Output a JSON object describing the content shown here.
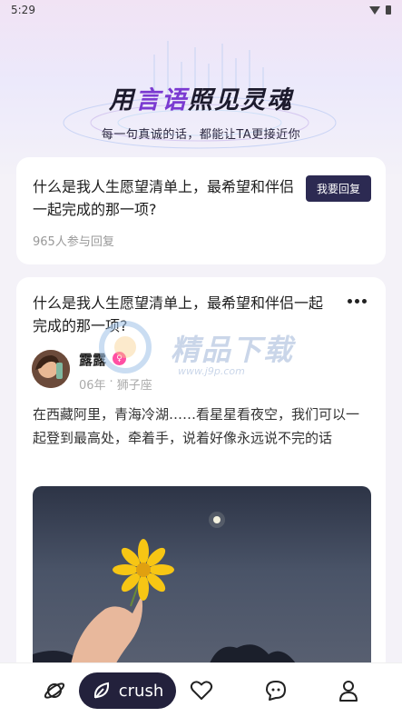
{
  "status_bar": {
    "time": "5:29"
  },
  "banner": {
    "slogan_part1": "用",
    "slogan_accent": "言语",
    "slogan_part2": "照见灵魂",
    "subtitle": "每一句真诚的话，都能让TA更接近你"
  },
  "question_card": {
    "question": "什么是我人生愿望清单上，最希望和伴侣一起完成的那一项?",
    "reply_button": "我要回复",
    "participants": "965人参与回复"
  },
  "answer_card": {
    "question": "什么是我人生愿望清单上，最希望和伴侣一起完成的那一项?",
    "user": {
      "name": "露露",
      "gender_badge": "♀",
      "birth_year": "06年",
      "separator": "·",
      "zodiac": "狮子座"
    },
    "answer": "在西藏阿里，青海冷湖……看星星看夜空，我们可以一起登到最高处，牵着手，说着好像永远说不完的话"
  },
  "watermark": {
    "text": "精品下载",
    "url": "www.j9p.com"
  },
  "bottom_nav": {
    "items": [
      {
        "icon": "planet-icon"
      },
      {
        "icon": "leaf-icon",
        "label": "crush"
      },
      {
        "icon": "heart-icon"
      },
      {
        "icon": "chat-icon"
      },
      {
        "icon": "person-icon"
      }
    ]
  },
  "colors": {
    "accent": "#7b3ad1",
    "button_dark": "#2c2a52",
    "nav_active": "#23213c",
    "badge_pink": "#ff4fa3"
  }
}
